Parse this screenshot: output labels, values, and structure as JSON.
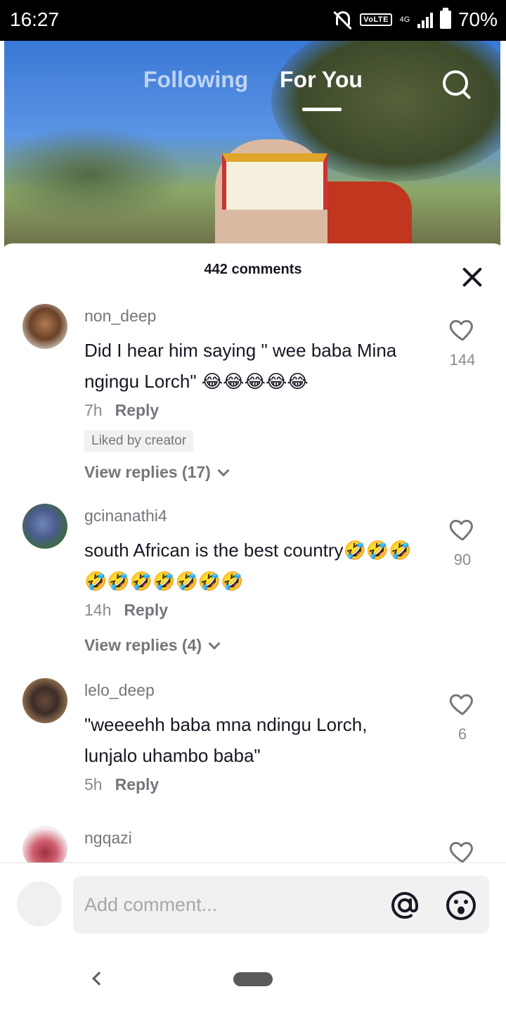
{
  "status_bar": {
    "time": "16:27",
    "volte": "VoLTE",
    "network": "4G",
    "battery": "70%"
  },
  "video": {
    "tabs": [
      {
        "label": "Following",
        "active": false
      },
      {
        "label": "For You",
        "active": true
      }
    ]
  },
  "comments_panel": {
    "count_label": "442 comments",
    "comments": [
      {
        "username": "non_deep",
        "text": "Did I hear him saying \" wee baba Mina ngingu Lorch\" 😂😂😂😂😂",
        "time": "7h",
        "reply_label": "Reply",
        "liked_by_creator": "Liked by creator",
        "view_replies": "View replies (17)",
        "likes": "144"
      },
      {
        "username": "gcinanathi4",
        "text": "south African is the best country🤣🤣🤣🤣🤣🤣🤣🤣🤣🤣",
        "time": "14h",
        "reply_label": "Reply",
        "view_replies": "View replies (4)",
        "likes": "90"
      },
      {
        "username": "lelo_deep",
        "text": "\"weeeehh baba mna ndingu Lorch, lunjalo uhambo baba\"",
        "time": "5h",
        "reply_label": "Reply",
        "likes": "6"
      },
      {
        "username": "ngqazi"
      }
    ]
  },
  "comment_input": {
    "placeholder": "Add comment..."
  },
  "icons": {
    "search": "search-icon",
    "close": "close-icon",
    "heart": "heart-icon",
    "mention": "at-sign-icon",
    "emoji": "emoji-icon",
    "back": "back-icon"
  }
}
